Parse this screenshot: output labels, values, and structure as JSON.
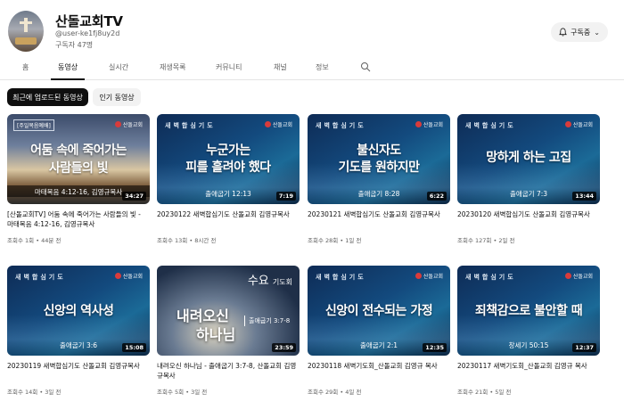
{
  "channel": {
    "name": "산돌교회TV",
    "handle": "@user-ke1fj8uy2d",
    "subscribers": "구독자 47명",
    "subscribe_label": "구독중"
  },
  "tabs": [
    "홈",
    "동영상",
    "실시간",
    "재생목록",
    "커뮤니티",
    "채널",
    "정보"
  ],
  "chips": {
    "recent": "최근에 업로드된 동영상",
    "popular": "인기 동영상"
  },
  "thumb_common": {
    "dawn_header": "새벽합심기도",
    "church": "산돌교회",
    "wed_big": "수요",
    "wed_small": "기도회"
  },
  "videos": [
    {
      "thumb": {
        "tag": "[주일복음예배]",
        "l1": "어둠 속에 죽어가는",
        "l2": "사람들의 빛",
        "ref": "마태복음 4:12-16, 김영규목사",
        "dur": "34:27"
      },
      "title": "[산돌교회TV] 어둠 속에 죽어가는 사람들의 빛 - 마태복음 4:12-16, 김영규목사",
      "meta": "조회수 1회 • 44분 전"
    },
    {
      "thumb": {
        "l1": "누군가는",
        "l2": "피를 흘려야 했다",
        "ref": "출애굽기 12:13",
        "dur": "7:19"
      },
      "title": "20230122 새벽합심기도 산돌교회 김영규목사",
      "meta": "조회수 13회 • 8시간 전"
    },
    {
      "thumb": {
        "l1": "불신자도",
        "l2": "기도를 원하지만",
        "ref": "출애굽기 8:28",
        "dur": "6:22"
      },
      "title": "20230121 새벽합심기도 산돌교회 김영규목사",
      "meta": "조회수 28회 • 1일 전"
    },
    {
      "thumb": {
        "l1": "망하게 하는 고집",
        "ref": "출애굽기 7:3",
        "dur": "13:44"
      },
      "title": "20230120 새벽합심기도 산돌교회 김영규목사",
      "meta": "조회수 127회 • 2일 전"
    },
    {
      "thumb": {
        "l1": "신앙의 역사성",
        "ref": "출애굽기 3:6",
        "dur": "15:08"
      },
      "title": "20230119 새벽합심기도 산돌교회 김영규목사",
      "meta": "조회수 14회 • 3일 전"
    },
    {
      "thumb": {
        "l1": "내려오신",
        "l2": "하나님",
        "ref": "출애굽기 3:7-8",
        "dur": "23:59"
      },
      "title": "내려오신 하나님 - 출애굽기 3:7-8, 산돌교회 김영규목사",
      "meta": "조회수 5회 • 3일 전"
    },
    {
      "thumb": {
        "l1": "신앙이 전수되는 가정",
        "ref": "출애굽기 2:1",
        "dur": "12:35"
      },
      "title": "20230118 새벽기도회_산돌교회 김영규 목사",
      "meta": "조회수 29회 • 4일 전"
    },
    {
      "thumb": {
        "l1": "죄책감으로 불안할 때",
        "ref": "창세기 50:15",
        "dur": "12:37"
      },
      "title": "20230117 새벽기도회_산돌교회 김영규 목사",
      "meta": "조회수 21회 • 5일 전"
    }
  ]
}
